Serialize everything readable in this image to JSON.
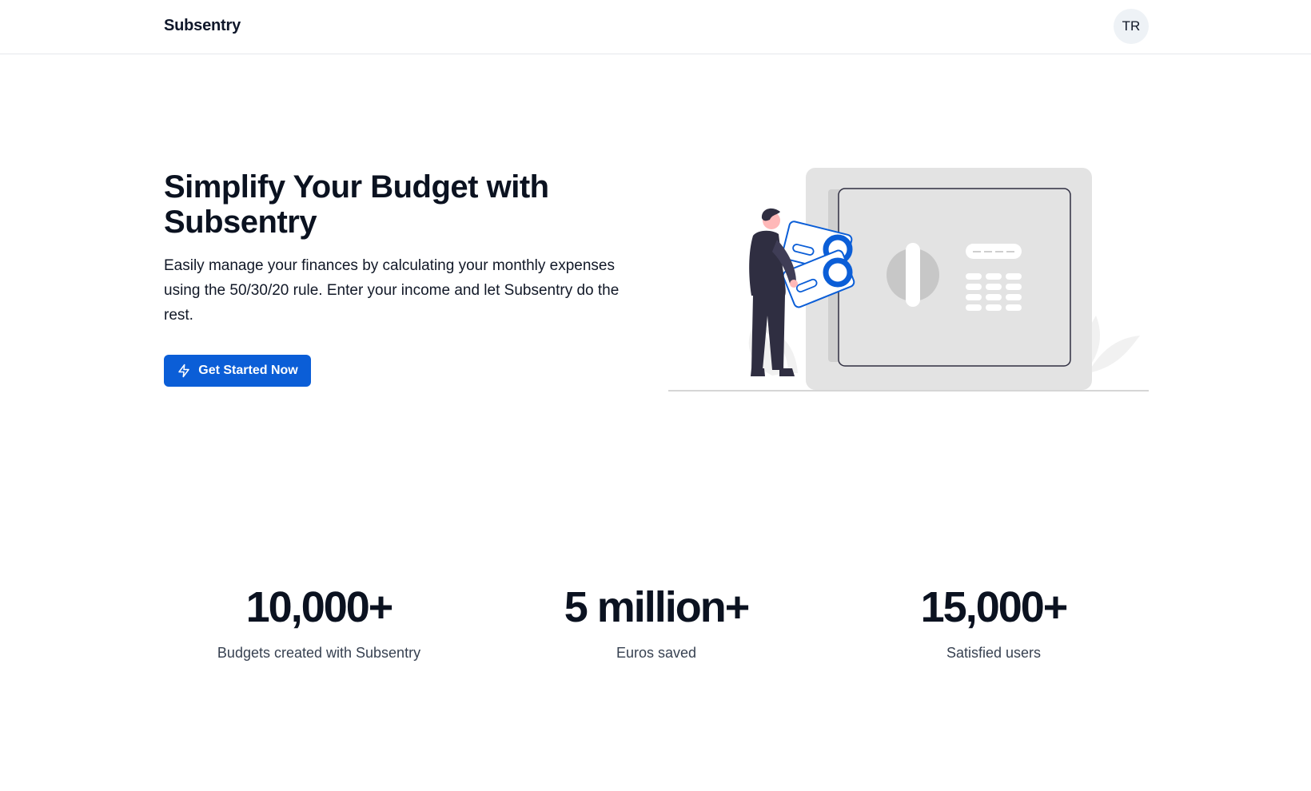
{
  "header": {
    "brand": "Subsentry",
    "avatar_initials": "TR"
  },
  "hero": {
    "title": "Simplify Your Budget with Subsentry",
    "description": "Easily manage your finances by calculating your monthly expenses using the 50/30/20 rule. Enter your income and let Subsentry do the rest.",
    "cta_label": "Get Started Now",
    "cta_icon": "lightning-bolt-icon",
    "illustration": "person-with-cards-and-safe-illustration"
  },
  "stats": [
    {
      "value": "10,000+",
      "label": "Budgets created with Subsentry"
    },
    {
      "value": "5 million+",
      "label": "Euros saved"
    },
    {
      "value": "15,000+",
      "label": "Satisfied users"
    }
  ],
  "colors": {
    "accent": "#0b5ed7",
    "text_dark": "#0b1220",
    "muted": "#374151",
    "border": "#e5e7eb",
    "avatar_bg": "#eef2f6",
    "illustration_gray": "#e3e3e3",
    "illustration_blue": "#0b5ed7"
  }
}
